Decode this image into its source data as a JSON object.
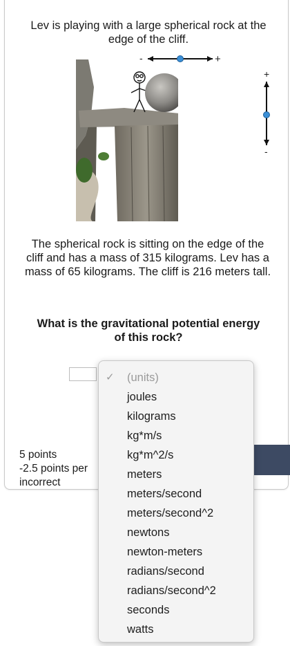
{
  "problem": {
    "intro": "Lev is playing with a large spherical rock at the edge of the cliff.",
    "description": "The spherical rock is sitting on the edge of the cliff and has a mass of 315 kilograms. Lev has a mass of 65 kilograms.  The cliff is 216 meters tall.",
    "question": "What is the gravitational potential energy of this rock?"
  },
  "sliders": {
    "horizontal": {
      "minus_label": "-",
      "plus_label": "+",
      "level": 0.5
    },
    "vertical": {
      "plus_label": "+",
      "minus_label": "-",
      "level": 0.5
    }
  },
  "scoring": {
    "points": "5 points",
    "penalty": "-2.5 points per",
    "penalty_suffix": "incorrect"
  },
  "units_dropdown": {
    "selected": "(units)",
    "options": [
      "(units)",
      "joules",
      "kilograms",
      "kg*m/s",
      "kg*m^2/s",
      "meters",
      "meters/second",
      "meters/second^2",
      "newtons",
      "newton-meters",
      "radians/second",
      "radians/second^2",
      "seconds",
      "watts"
    ]
  },
  "colors": {
    "slider_knob": "#3b8fd6",
    "submit_bar": "#3d4a63",
    "placeholder_text": "#9a9a9a"
  }
}
